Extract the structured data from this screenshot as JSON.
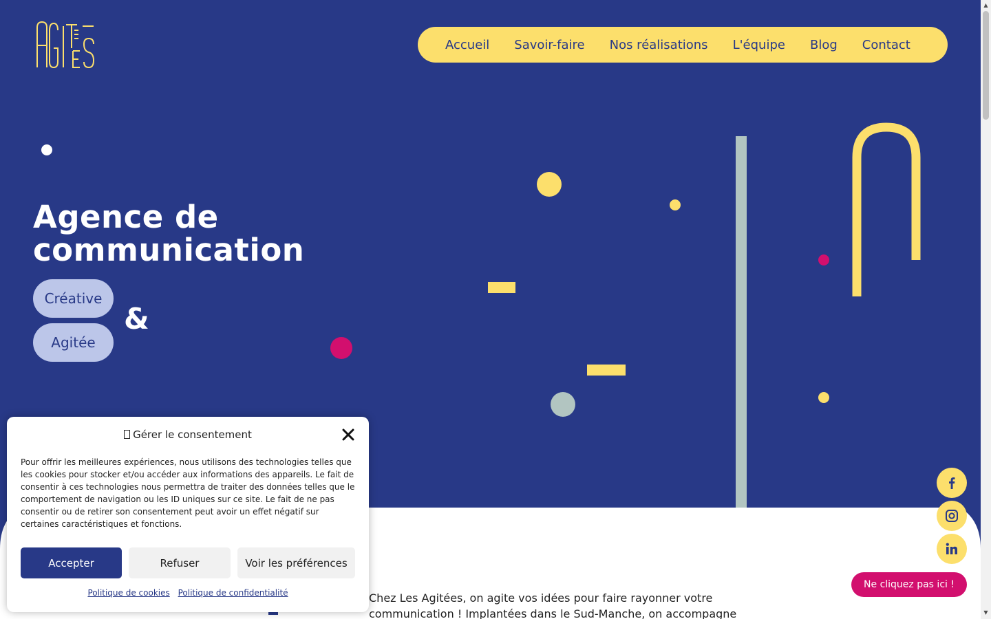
{
  "brand": {
    "logo_text": "AGITÉES"
  },
  "nav": {
    "items": [
      {
        "label": "Accueil"
      },
      {
        "label": "Savoir-faire"
      },
      {
        "label": "Nos réalisations"
      },
      {
        "label": "L'équipe"
      },
      {
        "label": "Blog"
      },
      {
        "label": "Contact"
      }
    ]
  },
  "hero": {
    "title_line1": "Agence de",
    "title_line2": "communication",
    "pill1": "Créative",
    "pill2": "Agitée",
    "ampersand": "&"
  },
  "intro": {
    "text": "Chez Les Agitées, on agite vos idées pour faire rayonner votre communication ! Implantées dans le Sud-Manche, on accompagne"
  },
  "cookie": {
    "title_icon": "gear-icon",
    "title": "Gérer le consentement",
    "body": "Pour offrir les meilleures expériences, nous utilisons des technologies telles que les cookies pour stocker et/ou accéder aux informations des appareils. Le fait de consentir à ces technologies nous permettra de traiter des données telles que le comportement de navigation ou les ID uniques sur ce site. Le fait de ne pas consentir ou de retirer son consentement peut avoir un effet négatif sur certaines caractéristiques et fonctions.",
    "accept": "Accepter",
    "refuse": "Refuser",
    "preferences": "Voir les préférences",
    "link_cookies": "Politique de cookies",
    "link_privacy": "Politique de confidentialité"
  },
  "social": [
    {
      "icon": "facebook-icon"
    },
    {
      "icon": "instagram-icon"
    },
    {
      "icon": "linkedin-icon"
    }
  ],
  "cta": {
    "label": "Ne cliquez pas ici !"
  },
  "colors": {
    "navy": "#283987",
    "yellow": "#fcdf6c",
    "pink": "#d20f6e",
    "lavender": "#bcc6e9",
    "sage": "#b2c5c1"
  }
}
